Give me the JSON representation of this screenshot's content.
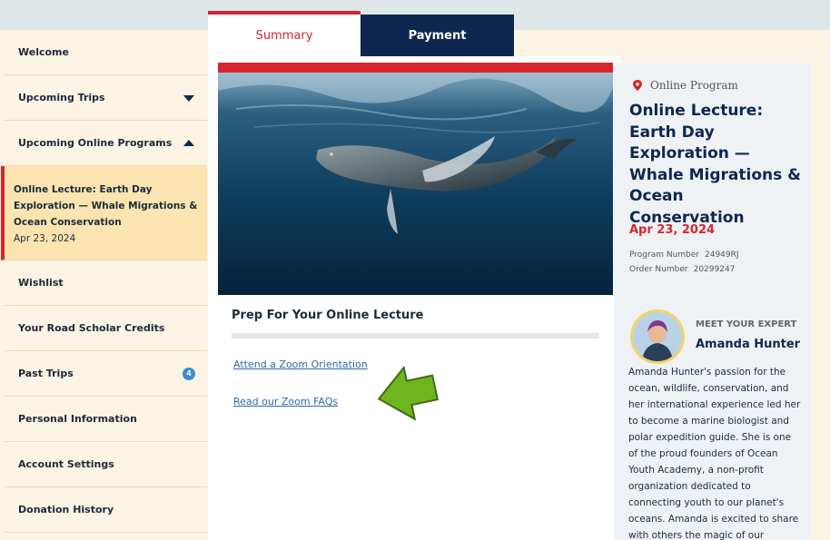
{
  "tabs": {
    "summary": "Summary",
    "payment": "Payment"
  },
  "sidebar": {
    "items": [
      {
        "label": "Welcome"
      },
      {
        "label": "Upcoming Trips"
      },
      {
        "label": "Upcoming Online Programs"
      },
      {
        "label": "Wishlist"
      },
      {
        "label": "Your Road Scholar Credits"
      },
      {
        "label": "Past Trips",
        "badge": "4"
      },
      {
        "label": "Personal Information"
      },
      {
        "label": "Account Settings"
      },
      {
        "label": "Donation History"
      }
    ],
    "active": {
      "title": "Online Lecture: Earth Day Exploration — Whale Migrations & Ocean Conservation",
      "date": "Apr 23, 2024"
    }
  },
  "main": {
    "prep_title": "Prep For Your Online Lecture",
    "links": [
      "Attend a Zoom Orientation",
      "Read our Zoom FAQs"
    ]
  },
  "program": {
    "location": "Online Program",
    "title": "Online Lecture: Earth Day Exploration — Whale Migrations & Ocean Conservation",
    "date": "Apr 23, 2024",
    "program_number_label": "Program Number",
    "program_number": "24949RJ",
    "order_number_label": "Order Number",
    "order_number": "20299247"
  },
  "expert": {
    "heading": "MEET YOUR EXPERT",
    "name": "Amanda Hunter",
    "bio": "Amanda Hunter's passion for the ocean, wildlife, conservation, and her international experience led her to become a marine biologist and polar expedition guide. She is one of the proud founders of Ocean Youth Academy, a non-profit organization dedicated to connecting youth to our planet's oceans. Amanda is excited to share with others the magic of our natural world and to"
  },
  "colors": {
    "navy": "#0e2650",
    "red": "#d3262e",
    "cream": "#fbf3e4",
    "active_bg": "#fbe4b0",
    "arrow_green": "#6fb51f"
  }
}
